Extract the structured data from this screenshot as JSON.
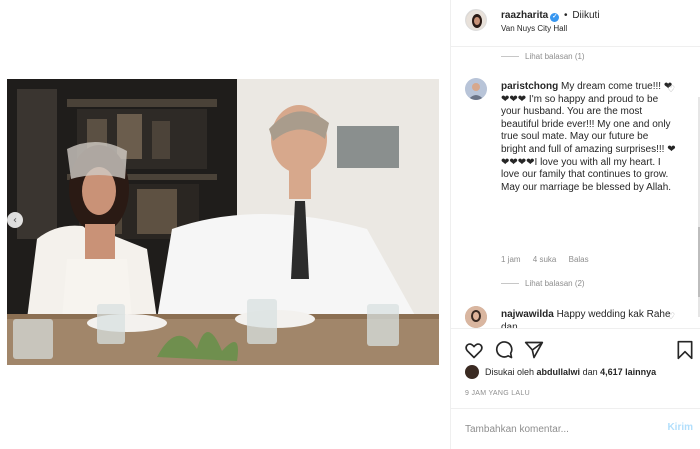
{
  "post": {
    "username": "raazharita",
    "separator": "•",
    "follow_status": "Diikuti",
    "location": "Van Nuys City Hall",
    "verified_icon": "verified-badge-icon"
  },
  "comments": {
    "replies_1": "Lihat balasan (1)",
    "comment_1": {
      "username": "paristchong",
      "text": "My dream come true!!! ❤❤❤❤ I'm so happy and proud to be your husband. You are the most beautiful bride ever!!! My one and only true soul mate. May our future be bright and full of amazing surprises!!! ❤❤❤❤❤I love you with all my heart. I love our family that continues to grow. May our marriage be blessed by Allah.",
      "time": "1 jam",
      "likes": "4 suka",
      "reply": "Balas"
    },
    "replies_2": "Lihat balasan (2)",
    "comment_2": {
      "username": "najwawilda",
      "text": "Happy wedding kak Rahe dan ..."
    }
  },
  "actions": {
    "liked_by_prefix": "Disukai oleh",
    "liked_by_user": "abdullalwi",
    "liked_by_and": "dan",
    "liked_by_count": "4,617 lainnya",
    "timestamp": "9 JAM YANG LALU"
  },
  "add_comment": {
    "placeholder": "Tambahkan komentar...",
    "post_label": "Kirim"
  },
  "colors": {
    "accent_blue": "#3897f0",
    "post_disabled": "#b2dffc",
    "muted": "#8e8e8e"
  }
}
